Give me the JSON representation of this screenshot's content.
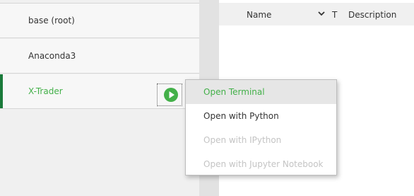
{
  "environments": [
    {
      "label": "base (root)"
    },
    {
      "label": "Anaconda3"
    },
    {
      "label": "X-Trader"
    }
  ],
  "table": {
    "col_name": "Name",
    "col_t": "T",
    "col_desc": "Description"
  },
  "context_menu": {
    "items": [
      {
        "label": "Open Terminal"
      },
      {
        "label": "Open with Python"
      },
      {
        "label": "Open with IPython"
      },
      {
        "label": "Open with Jupyter Notebook"
      }
    ]
  },
  "icons": {
    "play": "play-icon",
    "sort": "chevron-down-icon"
  },
  "colors": {
    "accent": "#43b049",
    "active_bar": "#1a7a3a",
    "disabled_text": "#c4c4c4"
  }
}
